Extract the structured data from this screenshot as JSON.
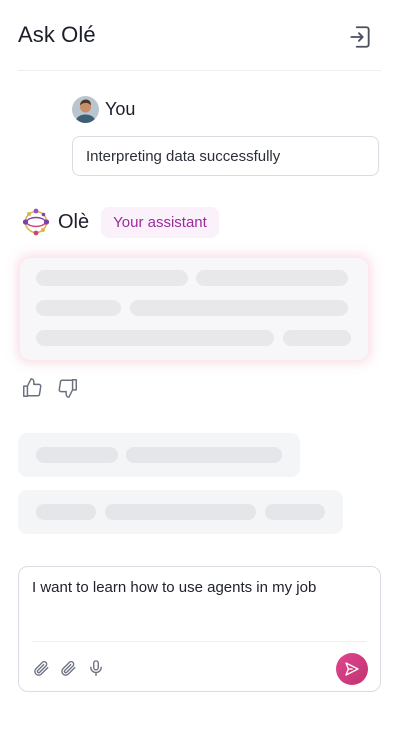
{
  "header": {
    "title": "Ask Olé",
    "exit_icon": "logout-icon"
  },
  "user_message": {
    "author": "You",
    "text": "Interpreting data successfully"
  },
  "assistant": {
    "name": "Olè",
    "badge": "Your assistant"
  },
  "composer": {
    "value": "I want to learn how to use agents in my job",
    "tools": [
      "paperclip-icon",
      "paperclip-icon",
      "microphone-icon"
    ],
    "send_icon": "send-icon"
  },
  "colors": {
    "accent": "#d63d82",
    "badge_text": "#9a2d9a",
    "badge_bg": "#fbf1fb"
  }
}
